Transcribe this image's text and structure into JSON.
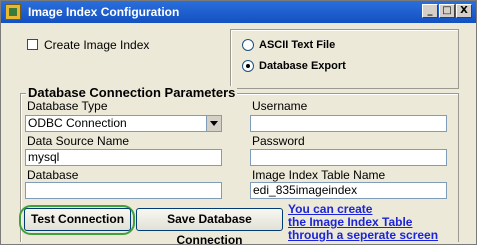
{
  "window": {
    "title": "Image Index Configuration",
    "controls": {
      "minimize": "_",
      "maximize": "□",
      "close": "X"
    }
  },
  "options": {
    "create_index_label": "Create Image Index",
    "create_index_checked": false,
    "format": {
      "ascii_label": "ASCII Text File",
      "database_label": "Database Export",
      "selected": "Database Export"
    }
  },
  "db": {
    "group_title": "Database Connection Parameters",
    "type_label": "Database Type",
    "type_value": "ODBC Connection",
    "dsn_label": "Data Source Name",
    "dsn_value": "mysql",
    "database_label": "Database",
    "database_value": "",
    "username_label": "Username",
    "username_value": "",
    "password_label": "Password",
    "password_value": "",
    "table_label": "Image Index Table Name",
    "table_value": "edi_835imageindex"
  },
  "buttons": {
    "test_label": "Test Connection",
    "save_label": "Save Database Connection"
  },
  "note": {
    "line1": "You can create",
    "line2": "the Image Index Table",
    "line3": "through a seperate screen"
  },
  "colors": {
    "titlebar": "#1450c0",
    "highlight": "#3ea13a",
    "link": "#1c24d8"
  }
}
